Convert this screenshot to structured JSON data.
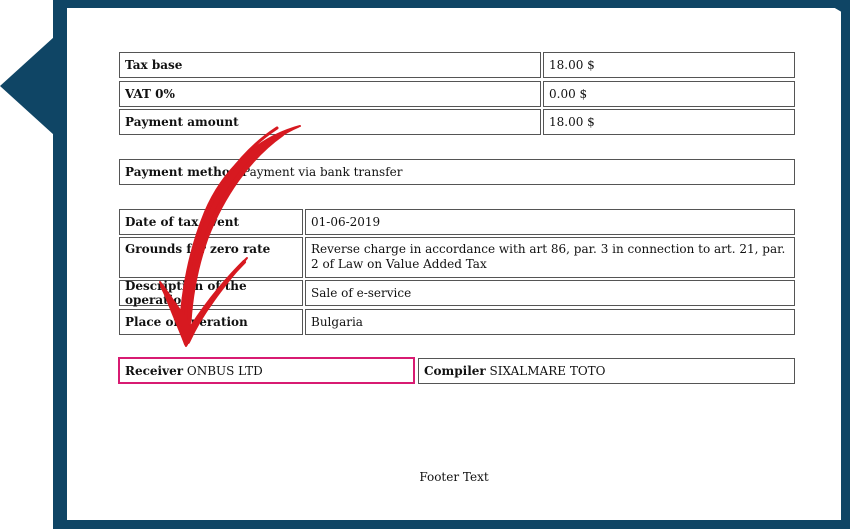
{
  "summary": {
    "rows": [
      {
        "label": "Tax base",
        "value": "18.00 $"
      },
      {
        "label": "VAT 0%",
        "value": "0.00 $"
      },
      {
        "label": "Payment amount",
        "value": "18.00 $"
      }
    ]
  },
  "payment": {
    "label": "Payment method",
    "value": "Payment via bank transfer"
  },
  "tax_details": {
    "rows": [
      {
        "label": "Date of tax event",
        "value": "01-06-2019"
      },
      {
        "label": "Grounds for zero rate",
        "value": "Reverse charge in accordance with art 86, par. 3 in connection to art. 21, par. 2 of Law on Value Added Tax"
      },
      {
        "label": "Description of the operation",
        "value": "Sale of e-service"
      },
      {
        "label": "Place of operation",
        "value": "Bulgaria"
      }
    ]
  },
  "parties": {
    "receiver_label": "Receiver",
    "receiver_value": "ONBUS LTD",
    "compiler_label": "Compiler",
    "compiler_value": "SIXALMARE TOTO"
  },
  "footer": {
    "text": "Footer Text"
  },
  "colors": {
    "frame": "#0f4565",
    "highlight": "#d81b72",
    "arrow": "#d71920"
  }
}
